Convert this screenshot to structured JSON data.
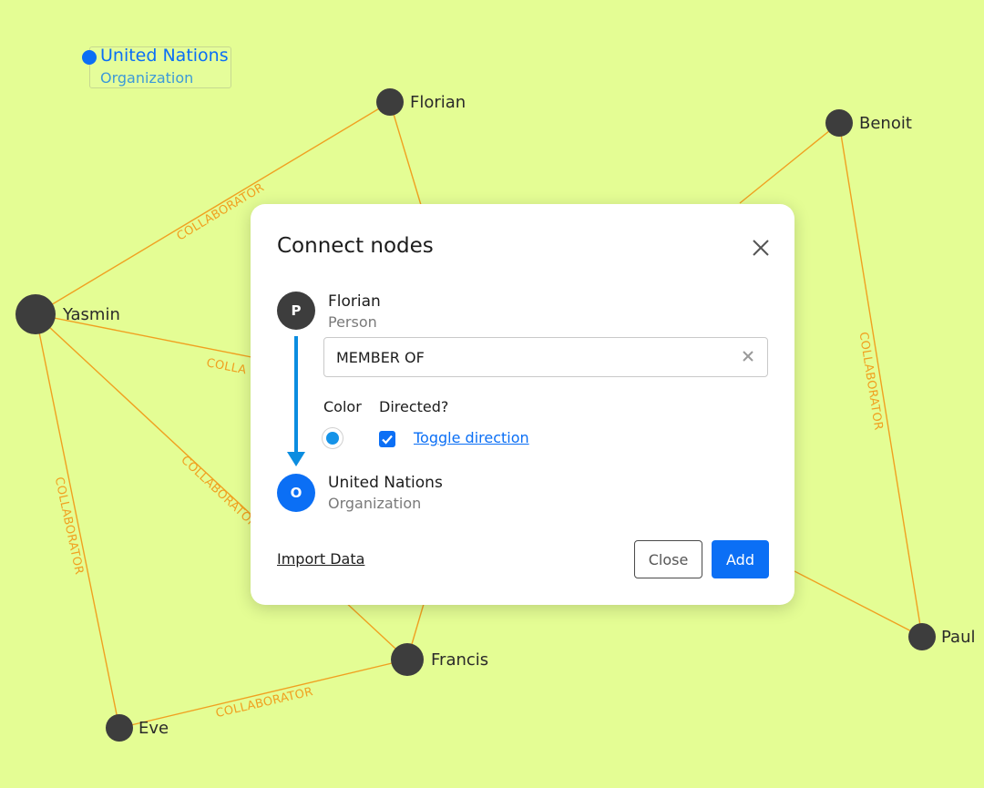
{
  "graph": {
    "nodes": {
      "florian": "Florian",
      "benoit": "Benoit",
      "yasmin": "Yasmin",
      "paul": "Paul",
      "francis": "Francis",
      "eve": "Eve"
    },
    "edge_labels": {
      "yasmin_florian": "COLLABORATOR",
      "benoit_paul": "COLLABORATOR",
      "yasmin_eve": "COLLABORATOR",
      "yasmin_francis": "COLLABORATOR",
      "yasmin_right_partial": "COLLA",
      "eve_francis": "COLLABORATOR"
    },
    "edge_color": "#f0a020",
    "node_color": "#3d3d3d",
    "background": "#e4fd94"
  },
  "selected_node": {
    "title": "United Nations",
    "subtitle": "Organization"
  },
  "dialog": {
    "title": "Connect nodes",
    "close_icon": "close-icon",
    "source": {
      "badge": "P",
      "name": "Florian",
      "type": "Person"
    },
    "relationship_value": "MEMBER OF",
    "color_label": "Color",
    "color_value": "#1593e8",
    "directed_label": "Directed?",
    "directed_checked": true,
    "toggle_direction": "Toggle direction",
    "target": {
      "badge": "O",
      "name": "United Nations",
      "type": "Organization"
    },
    "import_link": "Import Data",
    "close_button": "Close",
    "add_button": "Add",
    "accent": "#0b6ff5"
  }
}
